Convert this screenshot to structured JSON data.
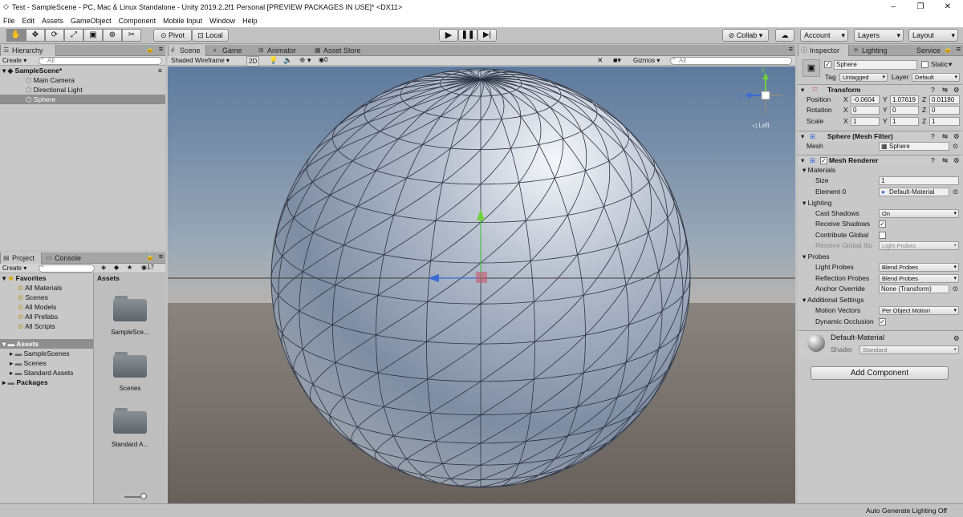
{
  "window": {
    "title": "Test - SampleScene - PC, Mac & Linux Standalone - Unity 2019.2.2f1 Personal [PREVIEW PACKAGES IN USE]* <DX11>"
  },
  "menu": [
    "File",
    "Edit",
    "Assets",
    "GameObject",
    "Component",
    "Mobile Input",
    "Window",
    "Help"
  ],
  "toolbar": {
    "pivot": "Pivot",
    "local": "Local",
    "collab": "Collab",
    "account": "Account",
    "layers": "Layers",
    "layout": "Layout"
  },
  "hierarchy": {
    "tab": "Hierarchy",
    "create": "Create",
    "search": "All",
    "scene": "SampleScene*",
    "items": [
      "Main Camera",
      "Directional Light",
      "Sphere"
    ]
  },
  "scene_tabs": [
    "Scene",
    "Game",
    "Animator",
    "Asset Store"
  ],
  "scene_bar": {
    "shading": "Shaded Wireframe",
    "mode2d": "2D",
    "fx_count": "0",
    "gizmos": "Gizmos",
    "search": "All",
    "view_label": "Left"
  },
  "project": {
    "tabs": [
      "Project",
      "Console"
    ],
    "create": "Create",
    "count": "17",
    "favorites": {
      "label": "Favorites",
      "items": [
        "All Materials",
        "Scenes",
        "All Models",
        "All Prefabs",
        "All Scripts"
      ]
    },
    "assets_root": "Assets",
    "asset_folders": [
      "SampleScenes",
      "Scenes",
      "Standard Assets"
    ],
    "packages": "Packages",
    "grid_header": "Assets",
    "grid_items": [
      "SampleSce...",
      "Scenes",
      "Standard A..."
    ]
  },
  "inspector": {
    "tabs": [
      "Inspector",
      "Lighting",
      "Service"
    ],
    "name": "Sphere",
    "static": "Static",
    "tag_label": "Tag",
    "tag": "Untagged",
    "layer_label": "Layer",
    "layer": "Default",
    "transform": {
      "title": "Transform",
      "rows": [
        {
          "label": "Position",
          "x": "-0.0604",
          "y": "1.07619",
          "z": "0.01180"
        },
        {
          "label": "Rotation",
          "x": "0",
          "y": "0",
          "z": "0"
        },
        {
          "label": "Scale",
          "x": "1",
          "y": "1",
          "z": "1"
        }
      ]
    },
    "mesh_filter": {
      "title": "Sphere (Mesh Filter)",
      "mesh_label": "Mesh",
      "mesh": "Sphere"
    },
    "mesh_renderer": {
      "title": "Mesh Renderer",
      "materials": "Materials",
      "size_label": "Size",
      "size": "1",
      "element_label": "Element 0",
      "element": "Default-Material",
      "lighting": "Lighting",
      "cast_shadows_label": "Cast Shadows",
      "cast_shadows": "On",
      "receive_shadows_label": "Receive Shadows",
      "contribute_gi_label": "Contribute Global",
      "receive_gi_label": "Receive Global Illu",
      "receive_gi": "Light Probes",
      "probes": "Probes",
      "light_probes_label": "Light Probes",
      "light_probes": "Blend Probes",
      "reflection_probes_label": "Reflection Probes",
      "reflection_probes": "Blend Probes",
      "anchor_label": "Anchor Override",
      "anchor": "None (Transform)",
      "additional": "Additional Settings",
      "motion_label": "Motion Vectors",
      "motion": "Per Object Motion",
      "dynamic_label": "Dynamic Occlusion"
    },
    "material": {
      "name": "Default-Material",
      "shader_label": "Shader",
      "shader": "Standard"
    },
    "add_component": "Add Component"
  },
  "status": {
    "text": "Auto Generate Lighting Off"
  }
}
